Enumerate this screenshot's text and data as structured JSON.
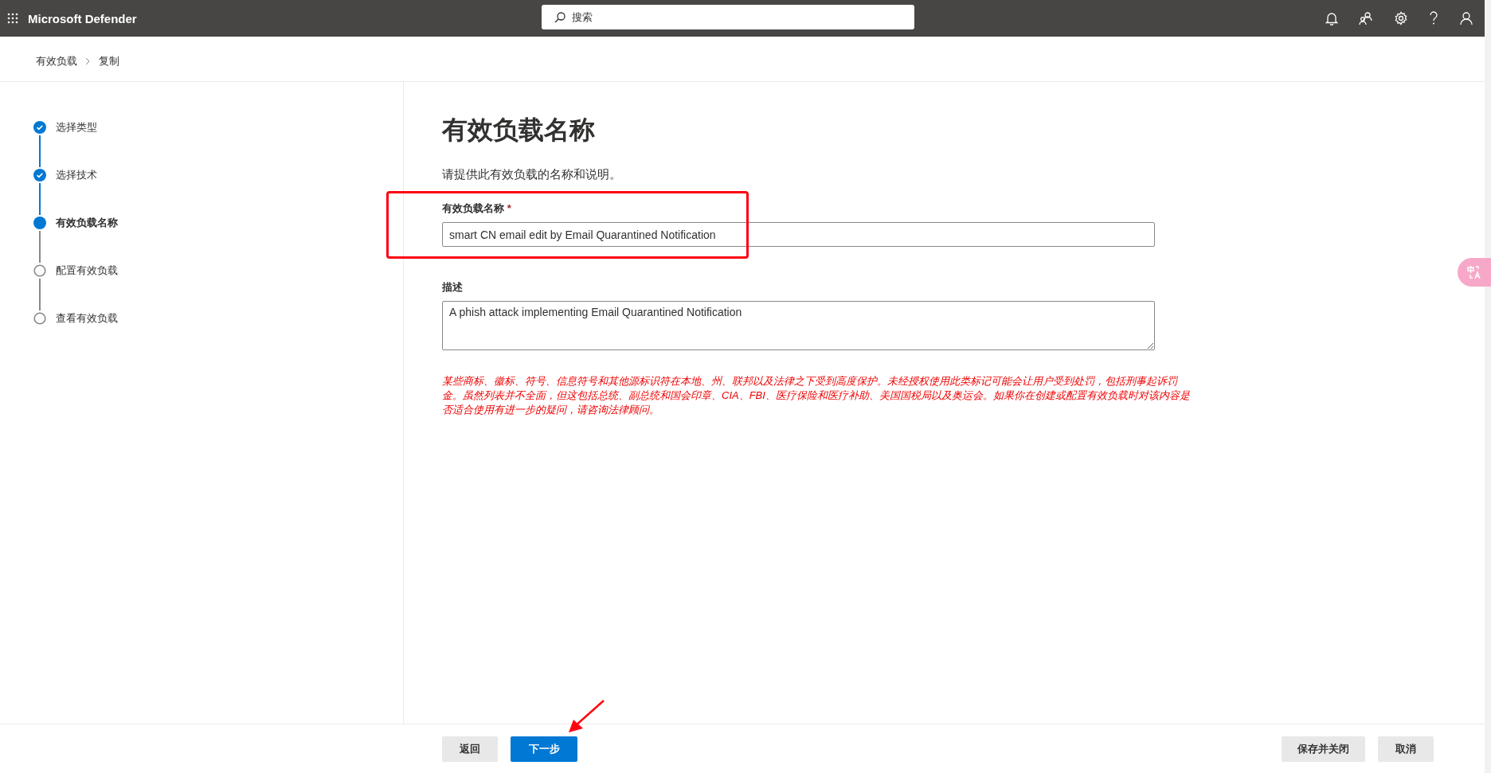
{
  "app": {
    "title": "Microsoft Defender",
    "search": {
      "placeholder": "搜索"
    }
  },
  "breadcrumb": [
    "有效负载",
    "复制"
  ],
  "steps": [
    {
      "label": "选择类型",
      "kind": "completed"
    },
    {
      "label": "选择技术",
      "kind": "completed"
    },
    {
      "label": "有效负载名称",
      "kind": "current"
    },
    {
      "label": "配置有效负载",
      "kind": "pending"
    },
    {
      "label": "查看有效负载",
      "kind": "pending"
    }
  ],
  "form": {
    "heading": "有效负载名称",
    "intro": "请提供此有效负载的名称和说明。",
    "name_field": {
      "label": "有效负载名称",
      "required": true,
      "required_mark": "*",
      "value": "smart CN email edit by Email Quarantined Notification"
    },
    "description_field": {
      "label": "描述",
      "value": "A phish attack implementing Email Quarantined Notification"
    },
    "warning": "某些商标、徽标、符号、信息符号和其他源标识符在本地、州、联邦以及法律之下受到高度保护。未经授权使用此类标记可能会让用户受到处罚，包括刑事起诉罚金。虽然列表并不全面，但这包括总统、副总统和国会印章、CIA、FBI、医疗保险和医疗补助、美国国税局以及奥运会。如果你在创建或配置有效负载时对该内容是否适合使用有进一步的疑问，请咨询法律顾问。"
  },
  "footer": {
    "left_buttons": [
      {
        "label": "返回",
        "kind": "secondary"
      },
      {
        "label": "下一步",
        "kind": "primary"
      }
    ],
    "right_buttons": [
      {
        "label": "保存并关闭",
        "kind": "secondary"
      },
      {
        "label": "取消",
        "kind": "secondary"
      }
    ]
  }
}
